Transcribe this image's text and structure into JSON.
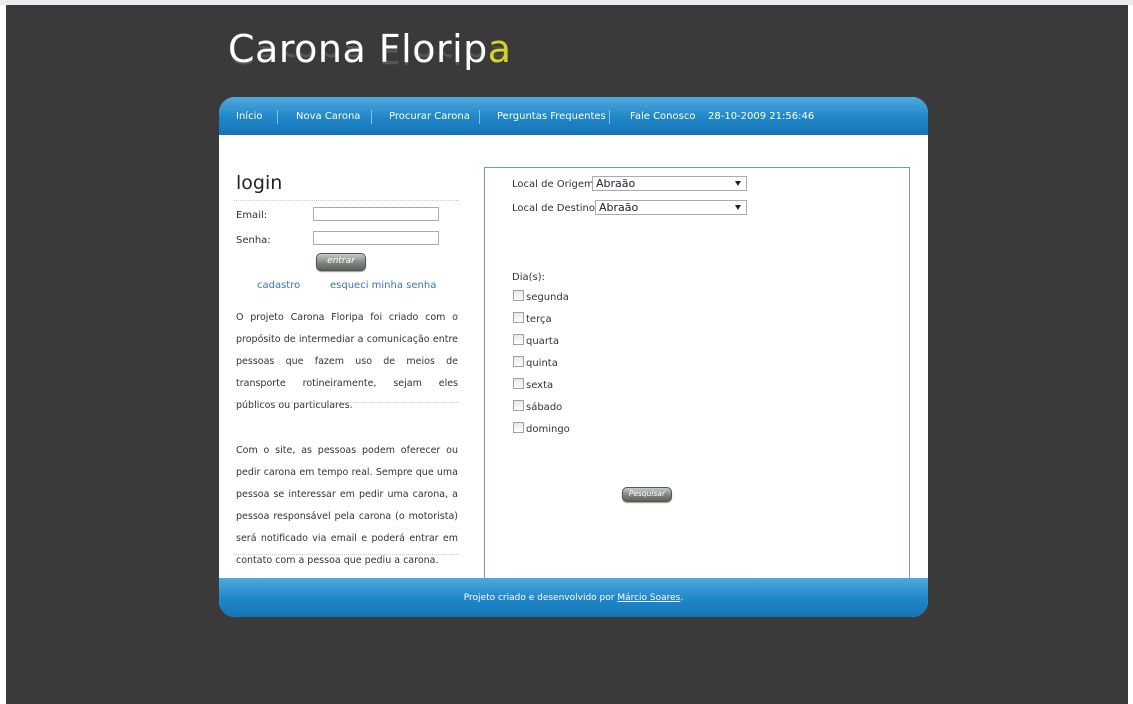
{
  "site": {
    "title_main": "Carona Florip",
    "title_accent": "a"
  },
  "nav": {
    "items": [
      {
        "label": "Início"
      },
      {
        "label": "Nova Carona"
      },
      {
        "label": "Procurar Carona"
      },
      {
        "label": "Perguntas Frequentes"
      },
      {
        "label": "Fale Conosco"
      }
    ],
    "datetime": "28-10-2009 21:56:46"
  },
  "login": {
    "title": "login",
    "email_label": "Email:",
    "email_value": "",
    "password_label": "Senha:",
    "password_value": "",
    "submit_label": "entrar",
    "register_link": "cadastro",
    "forgot_link": "esqueci minha senha"
  },
  "about": {
    "paragraph_1": "O projeto Carona Floripa foi criado com o propósito de intermediar a comunicação entre pessoas que fazem uso de meios de transporte rotineiramente, sejam eles públicos ou particulares.",
    "paragraph_2": "Com o site, as pessoas podem oferecer ou pedir carona em tempo real. Sempre que uma pessoa se interessar em pedir uma carona, a pessoa responsável pela carona (o motorista) será notificado via email e poderá entrar em contato com a pessoa que pediu a carona."
  },
  "search": {
    "origin_label": "Local de Origem:",
    "origin_value": "Abraão",
    "destination_label": "Local de Destino:",
    "destination_value": "Abraão",
    "days_label": "Dia(s):",
    "days": [
      {
        "label": "segunda",
        "checked": false
      },
      {
        "label": "terça",
        "checked": false
      },
      {
        "label": "quarta",
        "checked": false
      },
      {
        "label": "quinta",
        "checked": false
      },
      {
        "label": "sexta",
        "checked": false
      },
      {
        "label": "sábado",
        "checked": false
      },
      {
        "label": "domingo",
        "checked": false
      }
    ],
    "submit_label": "Pesquisar"
  },
  "footer": {
    "text_prefix": "Projeto criado e desenvolvido por ",
    "author_link": "Márcio Soares",
    "text_suffix": "."
  },
  "colors": {
    "background": "#3a3a3a",
    "nav_blue": "#1f86c8",
    "title_accent": "#d7d22e",
    "link": "#3c74b6",
    "panel_border": "#6a9ccb"
  }
}
